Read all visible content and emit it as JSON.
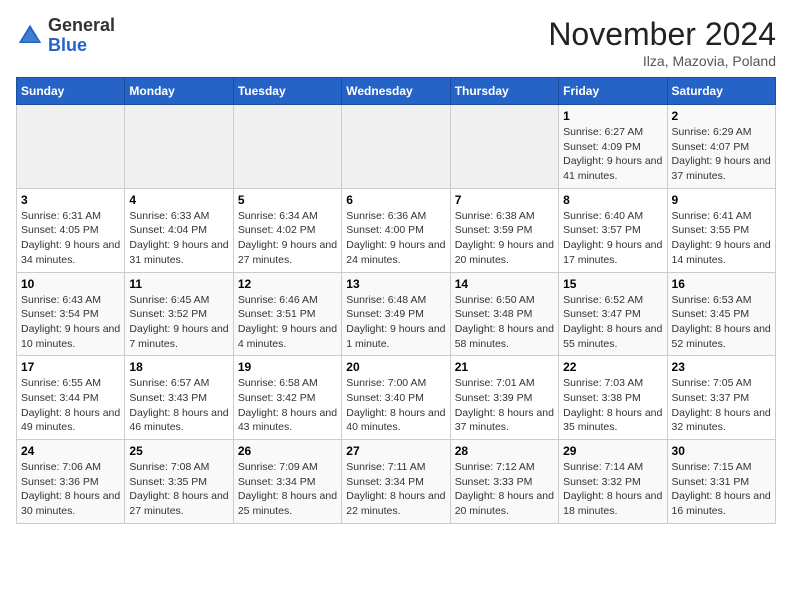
{
  "header": {
    "logo_general": "General",
    "logo_blue": "Blue",
    "month_title": "November 2024",
    "location": "Ilza, Mazovia, Poland"
  },
  "weekdays": [
    "Sunday",
    "Monday",
    "Tuesday",
    "Wednesday",
    "Thursday",
    "Friday",
    "Saturday"
  ],
  "weeks": [
    [
      {
        "day": "",
        "info": ""
      },
      {
        "day": "",
        "info": ""
      },
      {
        "day": "",
        "info": ""
      },
      {
        "day": "",
        "info": ""
      },
      {
        "day": "",
        "info": ""
      },
      {
        "day": "1",
        "info": "Sunrise: 6:27 AM\nSunset: 4:09 PM\nDaylight: 9 hours and 41 minutes."
      },
      {
        "day": "2",
        "info": "Sunrise: 6:29 AM\nSunset: 4:07 PM\nDaylight: 9 hours and 37 minutes."
      }
    ],
    [
      {
        "day": "3",
        "info": "Sunrise: 6:31 AM\nSunset: 4:05 PM\nDaylight: 9 hours and 34 minutes."
      },
      {
        "day": "4",
        "info": "Sunrise: 6:33 AM\nSunset: 4:04 PM\nDaylight: 9 hours and 31 minutes."
      },
      {
        "day": "5",
        "info": "Sunrise: 6:34 AM\nSunset: 4:02 PM\nDaylight: 9 hours and 27 minutes."
      },
      {
        "day": "6",
        "info": "Sunrise: 6:36 AM\nSunset: 4:00 PM\nDaylight: 9 hours and 24 minutes."
      },
      {
        "day": "7",
        "info": "Sunrise: 6:38 AM\nSunset: 3:59 PM\nDaylight: 9 hours and 20 minutes."
      },
      {
        "day": "8",
        "info": "Sunrise: 6:40 AM\nSunset: 3:57 PM\nDaylight: 9 hours and 17 minutes."
      },
      {
        "day": "9",
        "info": "Sunrise: 6:41 AM\nSunset: 3:55 PM\nDaylight: 9 hours and 14 minutes."
      }
    ],
    [
      {
        "day": "10",
        "info": "Sunrise: 6:43 AM\nSunset: 3:54 PM\nDaylight: 9 hours and 10 minutes."
      },
      {
        "day": "11",
        "info": "Sunrise: 6:45 AM\nSunset: 3:52 PM\nDaylight: 9 hours and 7 minutes."
      },
      {
        "day": "12",
        "info": "Sunrise: 6:46 AM\nSunset: 3:51 PM\nDaylight: 9 hours and 4 minutes."
      },
      {
        "day": "13",
        "info": "Sunrise: 6:48 AM\nSunset: 3:49 PM\nDaylight: 9 hours and 1 minute."
      },
      {
        "day": "14",
        "info": "Sunrise: 6:50 AM\nSunset: 3:48 PM\nDaylight: 8 hours and 58 minutes."
      },
      {
        "day": "15",
        "info": "Sunrise: 6:52 AM\nSunset: 3:47 PM\nDaylight: 8 hours and 55 minutes."
      },
      {
        "day": "16",
        "info": "Sunrise: 6:53 AM\nSunset: 3:45 PM\nDaylight: 8 hours and 52 minutes."
      }
    ],
    [
      {
        "day": "17",
        "info": "Sunrise: 6:55 AM\nSunset: 3:44 PM\nDaylight: 8 hours and 49 minutes."
      },
      {
        "day": "18",
        "info": "Sunrise: 6:57 AM\nSunset: 3:43 PM\nDaylight: 8 hours and 46 minutes."
      },
      {
        "day": "19",
        "info": "Sunrise: 6:58 AM\nSunset: 3:42 PM\nDaylight: 8 hours and 43 minutes."
      },
      {
        "day": "20",
        "info": "Sunrise: 7:00 AM\nSunset: 3:40 PM\nDaylight: 8 hours and 40 minutes."
      },
      {
        "day": "21",
        "info": "Sunrise: 7:01 AM\nSunset: 3:39 PM\nDaylight: 8 hours and 37 minutes."
      },
      {
        "day": "22",
        "info": "Sunrise: 7:03 AM\nSunset: 3:38 PM\nDaylight: 8 hours and 35 minutes."
      },
      {
        "day": "23",
        "info": "Sunrise: 7:05 AM\nSunset: 3:37 PM\nDaylight: 8 hours and 32 minutes."
      }
    ],
    [
      {
        "day": "24",
        "info": "Sunrise: 7:06 AM\nSunset: 3:36 PM\nDaylight: 8 hours and 30 minutes."
      },
      {
        "day": "25",
        "info": "Sunrise: 7:08 AM\nSunset: 3:35 PM\nDaylight: 8 hours and 27 minutes."
      },
      {
        "day": "26",
        "info": "Sunrise: 7:09 AM\nSunset: 3:34 PM\nDaylight: 8 hours and 25 minutes."
      },
      {
        "day": "27",
        "info": "Sunrise: 7:11 AM\nSunset: 3:34 PM\nDaylight: 8 hours and 22 minutes."
      },
      {
        "day": "28",
        "info": "Sunrise: 7:12 AM\nSunset: 3:33 PM\nDaylight: 8 hours and 20 minutes."
      },
      {
        "day": "29",
        "info": "Sunrise: 7:14 AM\nSunset: 3:32 PM\nDaylight: 8 hours and 18 minutes."
      },
      {
        "day": "30",
        "info": "Sunrise: 7:15 AM\nSunset: 3:31 PM\nDaylight: 8 hours and 16 minutes."
      }
    ]
  ]
}
